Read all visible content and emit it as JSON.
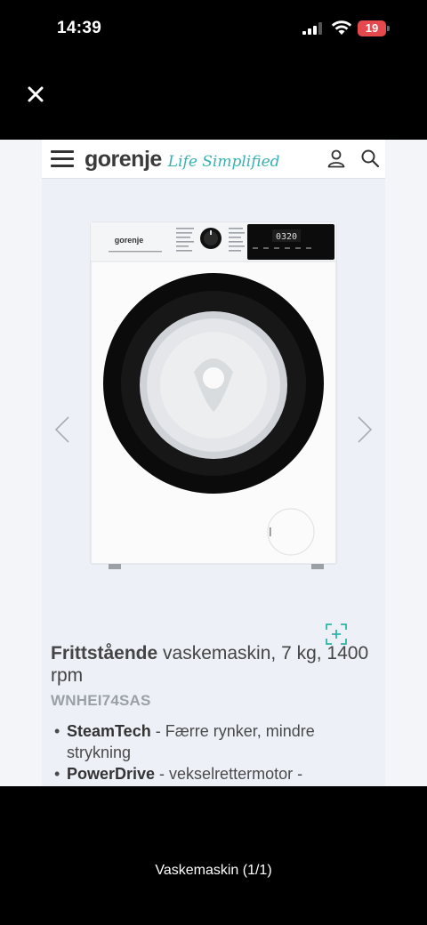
{
  "status_bar": {
    "time": "14:39",
    "battery": "19"
  },
  "website": {
    "logo_brand": "gorenje",
    "logo_tagline": "Life Simplified",
    "washer_brand": "gorenje",
    "washer_display": "0320",
    "product": {
      "title_bold": "Frittstående",
      "title_rest": " vaskemaskin, 7 kg, 1400 rpm",
      "sku": "WNHEI74SAS",
      "features": [
        {
          "name": "SteamTech",
          "text": " - Færre rynker, mindre strykning"
        },
        {
          "name": "PowerDrive",
          "text": " - vekselrettermotor -"
        }
      ]
    }
  },
  "viewer": {
    "caption": "Vaskemaskin (1/1)"
  }
}
